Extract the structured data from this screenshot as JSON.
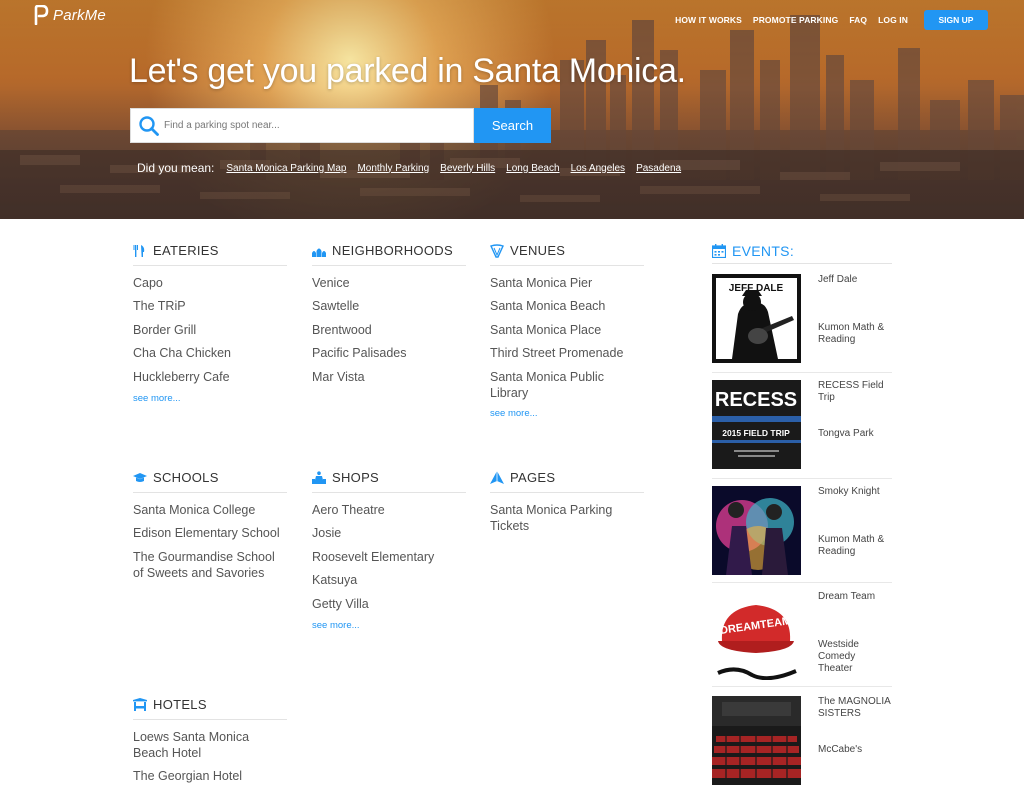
{
  "brand": {
    "name": "ParkMe"
  },
  "nav": {
    "how_it_works": "HOW IT WORKS",
    "promote": "PROMOTE PARKING",
    "faq": "FAQ",
    "login": "LOG IN",
    "signup": "SIGN UP"
  },
  "hero": {
    "headline": "Let's get you parked in Santa Monica.",
    "search_placeholder": "Find a parking spot near...",
    "search_button": "Search",
    "did_you_mean_label": "Did you mean:",
    "suggestions": [
      "Santa Monica Parking Map",
      "Monthly Parking",
      "Beverly Hills",
      "Long Beach",
      "Los Angeles",
      "Pasadena"
    ]
  },
  "sections": {
    "eateries": {
      "title": "EATERIES",
      "items": [
        "Capo",
        "The TRiP",
        "Border Grill",
        "Cha Cha Chicken",
        "Huckleberry Cafe"
      ],
      "more": "see more..."
    },
    "neighborhoods": {
      "title": "NEIGHBORHOODS",
      "items": [
        "Venice",
        "Sawtelle",
        "Brentwood",
        "Pacific Palisades",
        "Mar Vista"
      ]
    },
    "venues": {
      "title": "VENUES",
      "items": [
        "Santa Monica Pier",
        "Santa Monica Beach",
        "Santa Monica Place",
        "Third Street Promenade",
        "Santa Monica Public Library"
      ],
      "more": "see more..."
    },
    "schools": {
      "title": "SCHOOLS",
      "items": [
        "Santa Monica College",
        "Edison Elementary School",
        "The Gourmandise School of Sweets and Savories"
      ]
    },
    "shops": {
      "title": "SHOPS",
      "items": [
        "Aero Theatre",
        "Josie",
        "Roosevelt Elementary",
        "Katsuya",
        "Getty Villa"
      ],
      "more": "see more..."
    },
    "pages": {
      "title": "PAGES",
      "items": [
        "Santa Monica Parking Tickets"
      ]
    },
    "hotels": {
      "title": "HOTELS",
      "items": [
        "Loews Santa Monica Beach Hotel",
        "The Georgian Hotel"
      ]
    }
  },
  "events": {
    "title": "EVENTS:",
    "items": [
      {
        "name": "Jeff Dale",
        "venue": "Kumon Math & Reading",
        "poster_text": "JEFF DALE"
      },
      {
        "name": "RECESS Field Trip",
        "venue": "Tongva Park",
        "poster_text": "RECESS",
        "poster_sub": "2015 FIELD TRIP"
      },
      {
        "name": "Smoky Knight",
        "venue": "Kumon Math & Reading"
      },
      {
        "name": "Dream Team",
        "venue": "Westside Comedy Theater",
        "poster_text": "DREAMTEAM"
      },
      {
        "name": "The MAGNOLIA SISTERS",
        "venue": "McCabe's"
      }
    ]
  },
  "colors": {
    "accent": "#2196f3",
    "text": "#444444"
  }
}
